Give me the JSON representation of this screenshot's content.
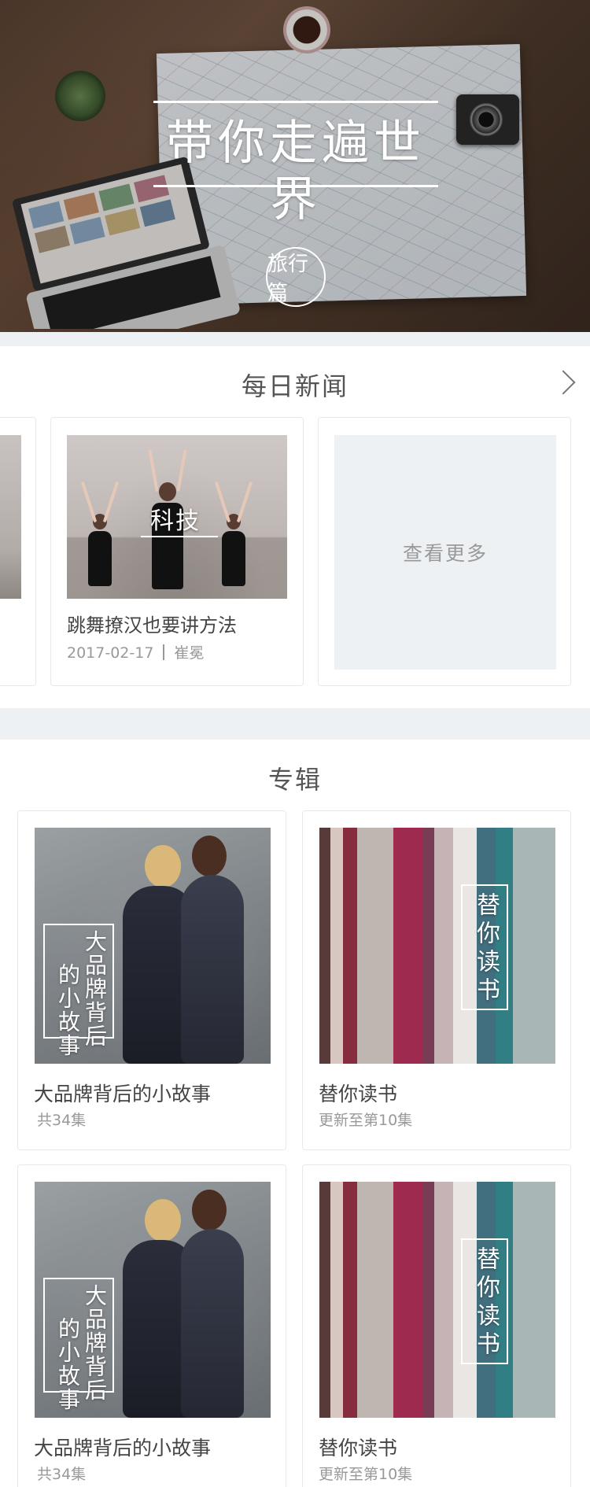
{
  "hero": {
    "title": "带你走遍世界",
    "badge": "旅行篇"
  },
  "news": {
    "section_title": "每日新闻",
    "items": [
      {
        "tag": "科技",
        "title": "跳舞撩汉也要讲方法",
        "date": "2017-02-17",
        "author": "崔冕"
      }
    ],
    "more_label": "查看更多"
  },
  "albums": {
    "section_title": "专辑",
    "items": [
      {
        "cover_text_a": "大品牌背后",
        "cover_text_b": "的小故事",
        "title": "大品牌背后的小故事",
        "sub": "共34集"
      },
      {
        "cover_text": "替你读书",
        "title": "替你读书",
        "sub": "更新至第10集"
      },
      {
        "cover_text_a": "大品牌背后",
        "cover_text_b": "的小故事",
        "title": "大品牌背后的小故事",
        "sub": "共34集"
      },
      {
        "cover_text": "替你读书",
        "title": "替你读书",
        "sub": "更新至第10集"
      }
    ]
  },
  "icons": {
    "more_arrow": "chevron-right-icon"
  }
}
